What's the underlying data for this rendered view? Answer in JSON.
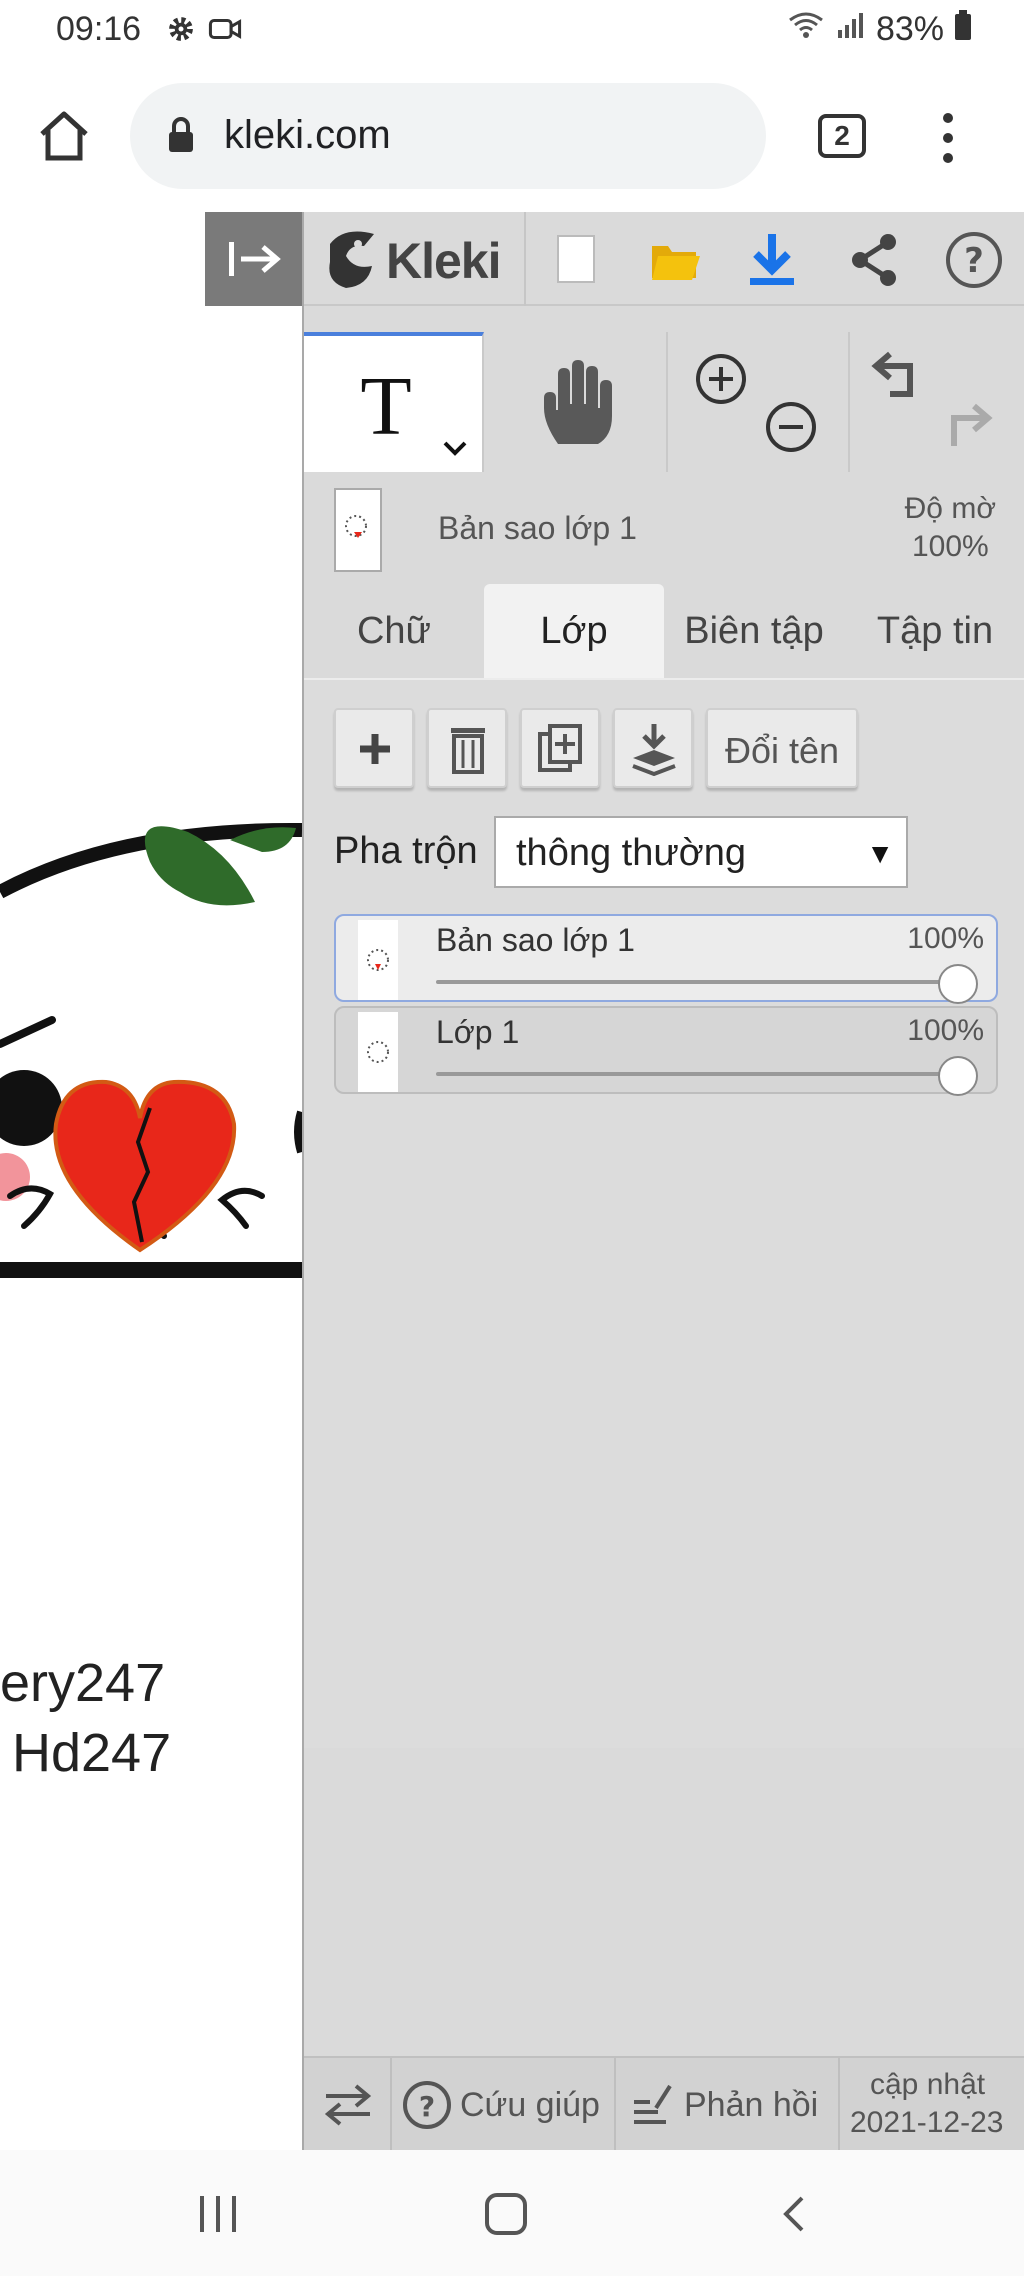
{
  "status_bar": {
    "time": "09:16",
    "battery": "83%"
  },
  "browser": {
    "url": "kleki.com",
    "tab_count": "2"
  },
  "canvas": {
    "credit_line1": "ery247",
    "credit_line2": "Hd247"
  },
  "app": {
    "logo": "Kleki",
    "layer_info": {
      "current_layer": "Bản sao lớp 1",
      "opacity_label": "Độ mờ",
      "opacity_value": "100%"
    },
    "tabs": [
      "Chữ",
      "Lớp",
      "Biên tập",
      "Tập tin"
    ],
    "active_tab": "Lớp",
    "layer_buttons": {
      "rename": "Đổi tên"
    },
    "blend": {
      "label": "Pha trộn",
      "value": "thông thường"
    },
    "layers": [
      {
        "name": "Bản sao lớp 1",
        "opacity": "100%",
        "opacity_fraction": 1.0,
        "active": true
      },
      {
        "name": "Lớp 1",
        "opacity": "100%",
        "opacity_fraction": 1.0,
        "active": false
      }
    ],
    "footer": {
      "help": "Cứu giúp",
      "feedback": "Phản hồi",
      "update_label": "cập nhật",
      "update_date": "2021-12-23"
    }
  },
  "colors": {
    "accent_blue": "#4a7fdc",
    "download_blue": "#1a73e8",
    "folder_yellow": "#f4c20d",
    "heart_red": "#e8271a",
    "leaf_green": "#2f6b2a"
  }
}
